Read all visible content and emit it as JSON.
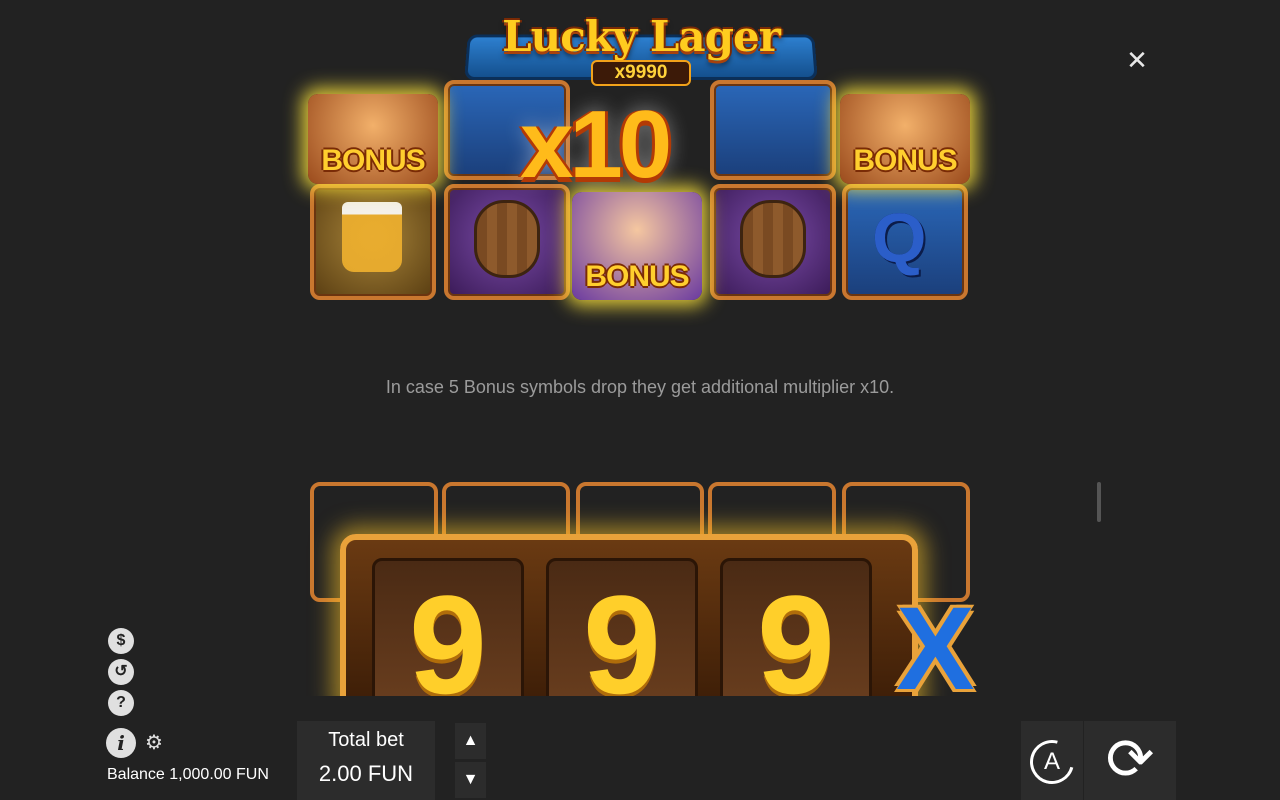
{
  "game": {
    "logo_title": "Lucky Lager",
    "logo_subtitle": "x9990"
  },
  "reels_top": {
    "bonus_label": "BONUS",
    "multiplier": "x10",
    "letter_symbol": "Q"
  },
  "caption": "In case 5 Bonus symbols drop they get additional multiplier x10.",
  "reels_bottom": {
    "digits": [
      "9",
      "9",
      "9"
    ],
    "x_symbol": "X"
  },
  "footer": {
    "balance_label": "Balance",
    "balance_value": "1,000.00 FUN",
    "total_bet_label": "Total bet",
    "total_bet_value": "2.00 FUN",
    "auto_label": "A"
  },
  "icons": {
    "close": "close-icon",
    "coins": "coins-icon",
    "history": "history-icon",
    "help": "help-icon",
    "info": "info-icon",
    "settings": "gear-icon",
    "bet_up": "arrow-up-icon",
    "bet_down": "arrow-down-icon",
    "autoplay": "autoplay-icon",
    "spin": "spin-icon"
  },
  "colors": {
    "background": "#222222",
    "panel": "#2c2c2c",
    "caption": "#9b9b9b",
    "gold": "#ffcf2a",
    "frame": "#e9a23a"
  }
}
